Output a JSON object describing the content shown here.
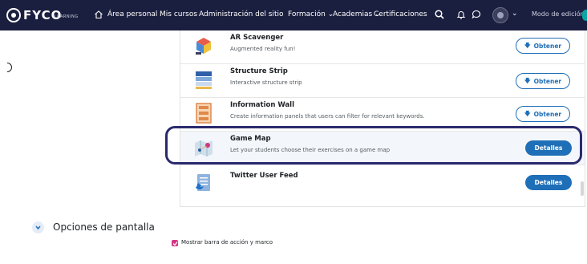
{
  "navbar": {
    "logo_text": "FYCO",
    "logo_sub": "LEARNING",
    "links": [
      "Área personal",
      "Mis cursos",
      "Administración del sitio",
      "Formación",
      "Academias",
      "Certificaciones"
    ],
    "edit_mode": "Modo de edición",
    "colors": {
      "background": "#1b1f3f"
    }
  },
  "plugins": [
    {
      "title": "AR Scavenger",
      "description": "Augmented reality fun!",
      "button": "Obtener",
      "icon": "ar-cube-icon"
    },
    {
      "title": "Structure Strip",
      "description": "Interactive structure strip",
      "button": "Obtener",
      "icon": "structure-strip-icon"
    },
    {
      "title": "Information Wall",
      "description": "Create information panels that users can filter for relevant keywords.",
      "button": "Obtener",
      "icon": "information-wall-icon"
    },
    {
      "title": "Game Map",
      "description": "Let your students choose their exercises on a game map",
      "button": "Detalles",
      "icon": "game-map-icon"
    },
    {
      "title": "Twitter User Feed",
      "description": "",
      "button": "Detalles",
      "icon": "twitter-feed-icon"
    }
  ],
  "screen_options": {
    "title": "Opciones de pantalla",
    "checkbox_label": "Mostrar barra de acción y marco",
    "checkbox_checked": true
  },
  "colors": {
    "accent": "#1f6fb8",
    "highlight": "#2a2a6e",
    "checkbox": "#d63384"
  }
}
